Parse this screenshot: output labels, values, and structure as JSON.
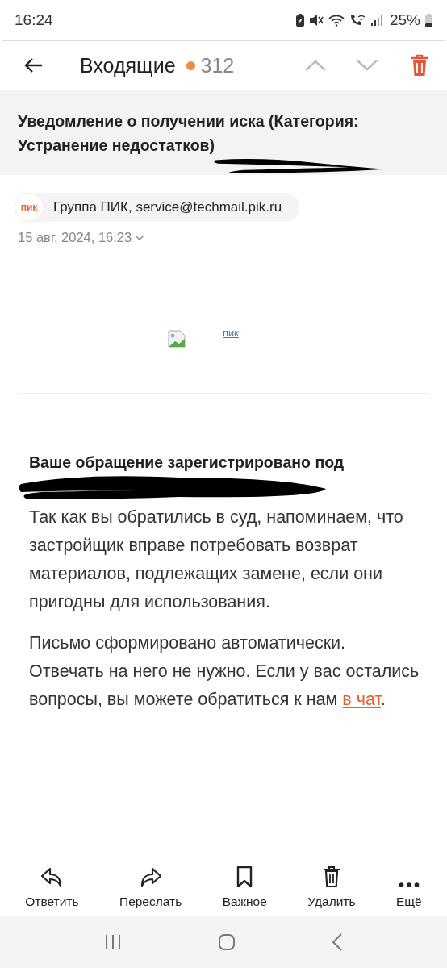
{
  "status_bar": {
    "time": "16:24",
    "battery": "25%"
  },
  "header": {
    "title": "Входящие",
    "unread_count": "312"
  },
  "message": {
    "subject": "Уведомление о получении иска (Категория: Устранение недостатков)",
    "sender": {
      "logo": "пик",
      "name": "Группа ПИК, service@techmail.pik.ru"
    },
    "date": "15 авг. 2024, 16:23",
    "image_link": "пик",
    "heading": "Ваше обращение зарегистрировано под",
    "paragraph": "Так как вы обратились в суд, напоминаем, что застройщик вправе потребовать возврат материалов, подлежащих замене, если они пригодны для использования.",
    "closing": {
      "text": "Письмо сформировано автоматически. Отвечать на него не нужно. Если у вас остались вопросы, вы можете обратиться к нам ",
      "link": "в чат",
      "after": "."
    }
  },
  "actions": [
    {
      "kind": "reply",
      "label": "Ответить"
    },
    {
      "kind": "forward",
      "label": "Переслать"
    },
    {
      "kind": "bookmark",
      "label": "Важное"
    },
    {
      "kind": "delete",
      "label": "Удалить"
    },
    {
      "kind": "more",
      "label": "Ещё"
    }
  ]
}
